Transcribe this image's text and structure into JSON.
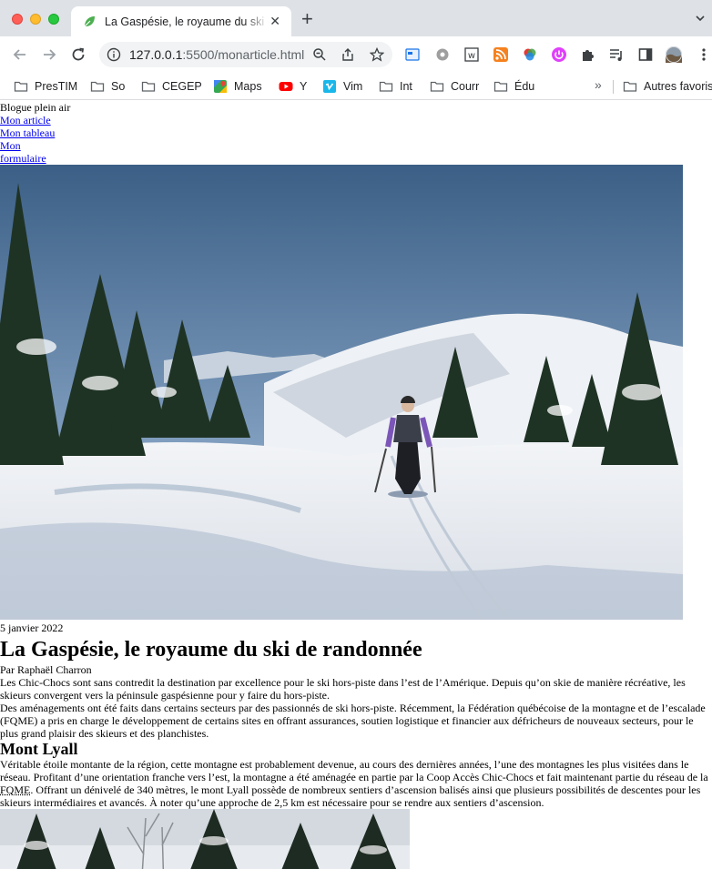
{
  "browser": {
    "tab_title": "La Gaspésie, le royaume du ski de randonnée",
    "url_host": "127.0.0.1",
    "url_path": ":5500/monarticle.html",
    "bookmarks": [
      "PresTIM",
      "So",
      "CEGEP",
      "Maps",
      "Y",
      "Vim",
      "Int",
      "Courr",
      "Édu"
    ],
    "other_bookmarks": "Autres favoris",
    "more_bookmarks": "»"
  },
  "site": {
    "name": "Blogue plein air",
    "nav": [
      "Mon article",
      "Mon tableau",
      "Mon formulaire"
    ]
  },
  "article": {
    "date": "5 janvier 2022",
    "title": "La Gaspésie, le royaume du ski de randonnée",
    "author": "Par Raphaël Charron",
    "intro_p1": "Les Chic-Chocs sont sans contredit la destination par excellence pour le ski hors-piste dans l’est de l’Amérique. Depuis qu’on skie de manière récréative, les skieurs convergent vers la péninsule gaspésienne pour y faire du hors-piste.",
    "intro_p2": "Des aménagements ont été faits dans certains secteurs par des passionnés de ski hors-piste. Récemment, la Fédération québécoise de la montagne et de l’escalade (FQME) a pris en charge le développement de certains sites en offrant assurances, soutien logistique et financier aux défricheurs de nouveaux secteurs, pour le plus grand plaisir des skieurs et des planchistes.",
    "section1_title": "Mont Lyall",
    "section1_p_part1": "Véritable étoile montante de la région, cette montagne est probablement devenue, au cours des dernières années, l’une des montagnes les plus visitées dans le réseau. Profitant d’une orientation franche vers l’est, la montagne a été aménagée en partie par la Coop Accès Chic-Chocs et fait maintenant partie du réseau de la ",
    "section1_abbr": "FQME",
    "section1_p_part2": ". Offrant un dénivelé de 340 mètres, le mont Lyall possède de nombreux sentiers d’ascension balisés ainsi que plusieurs possibilités de descentes pour les skieurs intermédiaires et avancés. À noter qu’une approche de 2,5 km est nécessaire pour se rendre aux sentiers d’ascension."
  }
}
